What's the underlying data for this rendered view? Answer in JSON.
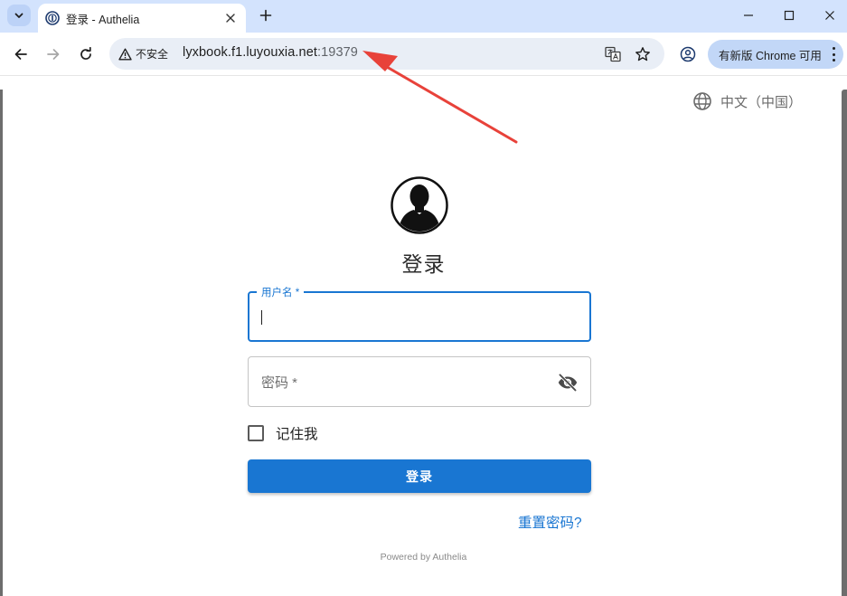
{
  "browser": {
    "tab": {
      "title": "登录 - Authelia"
    },
    "omnibox": {
      "security_label": "不安全",
      "host": "lyxbook.f1.luyouxia.net",
      "port": ":19379"
    },
    "update_chip": {
      "label": "有新版 Chrome 可用"
    },
    "icons": {
      "tab_menu": "chevron-down-icon",
      "favicon": "authelia-logo-icon",
      "tab_close": "close-icon",
      "new_tab": "plus-icon",
      "minimize": "minimize-icon",
      "maximize": "maximize-icon",
      "close_window": "close-icon",
      "back": "arrow-left-icon",
      "forward": "arrow-right-icon",
      "reload": "reload-icon",
      "security": "warning-triangle-icon",
      "translate": "translate-icon",
      "bookmark": "star-icon",
      "profile": "profile-icon",
      "menu": "kebab-menu-icon"
    },
    "colors": {
      "tabstrip": "#d3e3fd",
      "omnibox": "#e9eef6",
      "update_chip": "#c2d7f7"
    }
  },
  "page": {
    "language": {
      "label": "中文（中国）",
      "icon": "globe-icon"
    },
    "title": "登录",
    "avatar_icon": "user-silhouette-icon",
    "username": {
      "label": "用户名 *",
      "value": ""
    },
    "password": {
      "placeholder": "密码 *",
      "toggle_icon": "eye-off-icon"
    },
    "remember_me": {
      "label": "记住我",
      "checked": false
    },
    "submit": {
      "label": "登录"
    },
    "reset_link": {
      "label": "重置密码?"
    },
    "footer": {
      "text": "Powered by Authelia"
    },
    "colors": {
      "primary": "#1976d2",
      "annotation_arrow": "#e8423a"
    }
  }
}
